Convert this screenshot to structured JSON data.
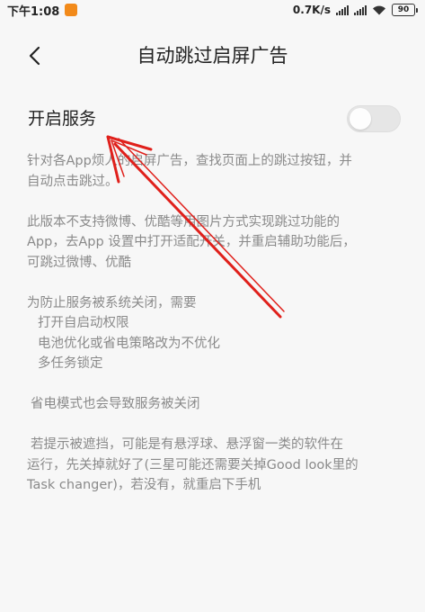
{
  "status_bar": {
    "time": "下午1:08",
    "net_speed": "0.7K/s",
    "battery": "90"
  },
  "header": {
    "title": "自动跳过启屏广告"
  },
  "service": {
    "label": "开启服务",
    "enabled": false
  },
  "description": {
    "p1": [
      "针对各App烦人的启屏广告，查找页面上的跳过按钮，并",
      "自动点击跳过。"
    ],
    "p2": [
      "此版本不支持微博、优酷等用图片方式实现跳过功能的",
      "App，去App 设置中打开适配开关，并重启辅助功能后，",
      "可跳过微博、优酷"
    ],
    "p3": {
      "intro": "为防止服务被系统关闭，需要",
      "items": [
        "打开自启动权限",
        "电池优化或省电策略改为不优化",
        "多任务锁定"
      ]
    },
    "p4": "省电模式也会导致服务被关闭",
    "p5": [
      "若提示被遮挡，可能是有悬浮球、悬浮窗一类的软件在",
      "运行，先关掉就好了(三星可能还需要关掉Good look里的",
      "Task changer)，若没有，就重启下手机"
    ]
  },
  "colors": {
    "background": "#f7f7f7",
    "annotation_arrow": "#e0201b",
    "app_badge": "#f28a1a"
  },
  "icons": {
    "back": "chevron-left-icon",
    "wifi": "wifi-icon",
    "signal": "signal-icon",
    "battery": "battery-icon"
  }
}
